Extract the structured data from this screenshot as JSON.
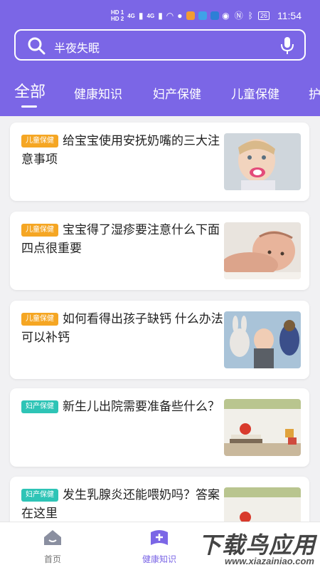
{
  "status_bar": {
    "left_indicators": [
      "HD 1",
      "HD 2"
    ],
    "network": "4G",
    "network2": "4G",
    "battery": "26",
    "time": "11:54"
  },
  "search": {
    "placeholder": "半夜失眠",
    "search_icon": "search-icon",
    "mic_icon": "microphone-icon"
  },
  "tabs": [
    {
      "label": "全部",
      "active": true
    },
    {
      "label": "健康知识",
      "active": false
    },
    {
      "label": "妇产保健",
      "active": false
    },
    {
      "label": "儿童保健",
      "active": false
    },
    {
      "label": "护",
      "active": false
    }
  ],
  "articles": [
    {
      "tag": "儿童保健",
      "title": "给宝宝使用安抚奶嘴的三大注意事项",
      "image": "baby-with-pacifier"
    },
    {
      "tag": "儿童保健",
      "title": "宝宝得了湿疹要注意什么下面四点很重要",
      "image": "baby-lying-down"
    },
    {
      "tag": "儿童保健",
      "title": "如何看得出孩子缺钙 什么办法可以补钙",
      "image": "child-with-toys"
    },
    {
      "tag": "妇产保健",
      "title": "新生儿出院需要准备些什么？",
      "image": "apple-on-books"
    },
    {
      "tag": "妇产保健",
      "title": "发生乳腺炎还能喂奶吗？答案在这里",
      "image": "apple-on-books"
    }
  ],
  "bottom_nav": [
    {
      "label": "首页",
      "icon": "home-icon",
      "active": false
    },
    {
      "label": "健康知识",
      "icon": "health-knowledge-icon",
      "active": true
    }
  ],
  "watermark": {
    "big": "下载鸟应用",
    "small": "www.xiazainiao.com"
  },
  "colors": {
    "primary": "#7b66e6",
    "child_tag": "#f5a623",
    "women_tag": "#2ec4b6"
  }
}
